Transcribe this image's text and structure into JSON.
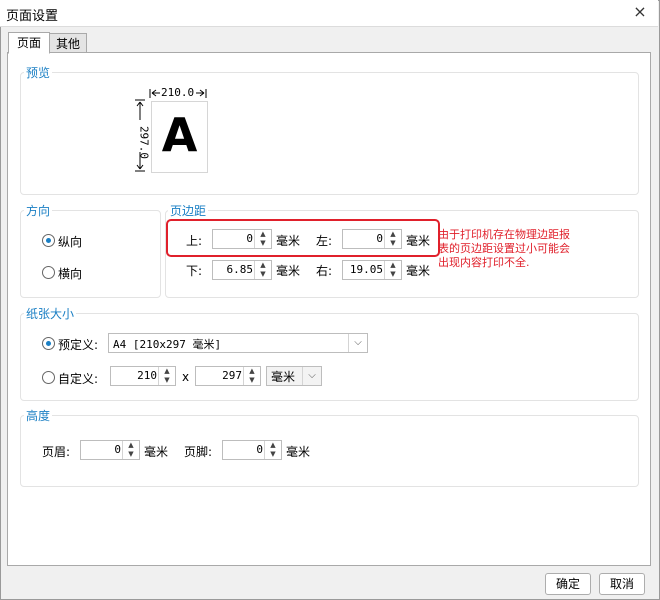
{
  "window": {
    "title": "页面设置",
    "close_icon": "×"
  },
  "tabs": [
    {
      "label": "页面",
      "active": true
    },
    {
      "label": "其他",
      "active": false
    }
  ],
  "preview": {
    "group_label": "预览",
    "width": "210.0",
    "height": "297.0",
    "letter": "A"
  },
  "orientation": {
    "group_label": "方向",
    "options": [
      {
        "label": "纵向",
        "selected": true
      },
      {
        "label": "横向",
        "selected": false
      }
    ]
  },
  "margins": {
    "group_label": "页边距",
    "top_label": "上:",
    "top_value": "0",
    "left_label": "左:",
    "left_value": "0",
    "bottom_label": "下:",
    "bottom_value": "6.85",
    "right_label": "右:",
    "right_value": "19.05",
    "unit": "毫米"
  },
  "annotation": {
    "text": "由于打印机存在物理边距报表的页边距设置过小可能会出现内容打印不全.",
    "color": "#e0202b"
  },
  "paper": {
    "group_label": "纸张大小",
    "predefined_label": "预定义:",
    "predefined_selected": true,
    "predefined_value": "A4 [210x297 毫米]",
    "custom_label": "自定义:",
    "custom_selected": false,
    "custom_width": "210",
    "times": "x",
    "custom_height": "297",
    "custom_unit": "毫米"
  },
  "height_group": {
    "group_label": "高度",
    "header_label": "页眉:",
    "header_value": "0",
    "footer_label": "页脚:",
    "footer_value": "0",
    "unit": "毫米"
  },
  "buttons": {
    "ok": "确定",
    "cancel": "取消"
  },
  "colors": {
    "accent": "#1a7fc4",
    "highlight": "#e0202b"
  }
}
